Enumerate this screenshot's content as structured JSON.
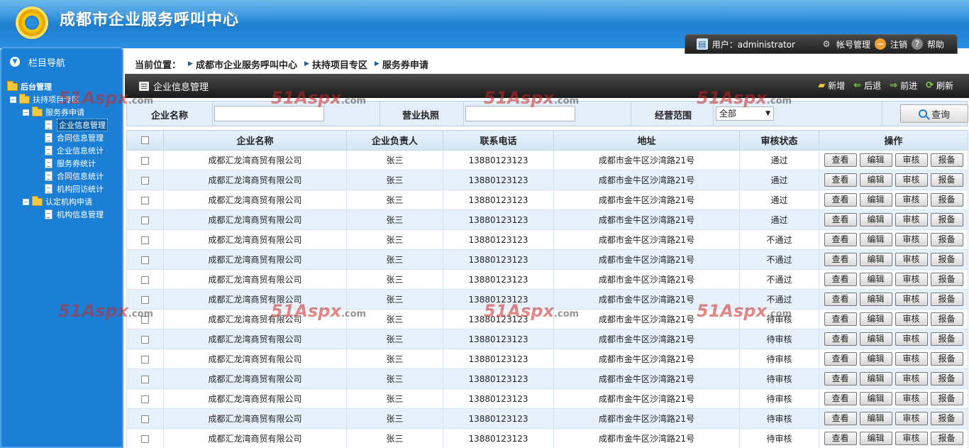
{
  "header": {
    "site_title": "成都市企业服务呼叫中心",
    "user_label": "用户：administrator",
    "account_link": "帐号管理",
    "logout_link": "注销",
    "help_link": "帮助"
  },
  "sidebar": {
    "title": "栏目导航",
    "tree": [
      {
        "label": "后台管理",
        "level": 0,
        "type": "folder",
        "bold": true
      },
      {
        "label": "扶持项目专区",
        "level": 1,
        "type": "folder",
        "toggle": "−"
      },
      {
        "label": "服务券申请",
        "level": 2,
        "type": "folder",
        "toggle": "−"
      },
      {
        "label": "企业信息管理",
        "level": 3,
        "type": "doc",
        "active": true
      },
      {
        "label": "合同信息管理",
        "level": 3,
        "type": "doc"
      },
      {
        "label": "企业信息统计",
        "level": 3,
        "type": "doc"
      },
      {
        "label": "服务券统计",
        "level": 3,
        "type": "doc"
      },
      {
        "label": "合同信息统计",
        "level": 3,
        "type": "doc"
      },
      {
        "label": "机构回访统计",
        "level": 3,
        "type": "doc"
      },
      {
        "label": "认定机构申请",
        "level": 2,
        "type": "folder",
        "toggle": "−"
      },
      {
        "label": "机构信息管理",
        "level": 3,
        "type": "doc"
      }
    ]
  },
  "breadcrumb": {
    "prefix": "当前位置：",
    "items": [
      "成都市企业服务呼叫中心",
      "扶持项目专区",
      "服务券申请"
    ]
  },
  "panel": {
    "title": "企业信息管理",
    "actions": [
      {
        "label": "新增",
        "icon": "folder-add-icon",
        "glyph": "▰",
        "cls": "a-new"
      },
      {
        "label": "后退",
        "icon": "back-arrow-icon",
        "glyph": "⇐",
        "cls": "a-back"
      },
      {
        "label": "前进",
        "icon": "forward-arrow-icon",
        "glyph": "⇒",
        "cls": "a-fwd"
      },
      {
        "label": "刷新",
        "icon": "refresh-icon",
        "glyph": "⟳",
        "cls": "a-refresh"
      }
    ]
  },
  "search": {
    "company_label": "企业名称",
    "company_value": "",
    "license_label": "营业执照",
    "license_value": "",
    "scope_label": "经营范围",
    "scope_selected": "全部",
    "query_button": "查询"
  },
  "table": {
    "headers": [
      "企业名称",
      "企业负责人",
      "联系电话",
      "地址",
      "审核状态",
      "操作"
    ],
    "row_buttons": [
      "查看",
      "编辑",
      "审核",
      "报备"
    ],
    "rows": [
      {
        "name": "成都汇龙湾商贸有限公司",
        "owner": "张三",
        "phone": "13880123123",
        "address": "成都市金牛区沙湾路21号",
        "status": "通过"
      },
      {
        "name": "成都汇龙湾商贸有限公司",
        "owner": "张三",
        "phone": "13880123123",
        "address": "成都市金牛区沙湾路21号",
        "status": "通过"
      },
      {
        "name": "成都汇龙湾商贸有限公司",
        "owner": "张三",
        "phone": "13880123123",
        "address": "成都市金牛区沙湾路21号",
        "status": "通过"
      },
      {
        "name": "成都汇龙湾商贸有限公司",
        "owner": "张三",
        "phone": "13880123123",
        "address": "成都市金牛区沙湾路21号",
        "status": "通过"
      },
      {
        "name": "成都汇龙湾商贸有限公司",
        "owner": "张三",
        "phone": "13880123123",
        "address": "成都市金牛区沙湾路21号",
        "status": "不通过"
      },
      {
        "name": "成都汇龙湾商贸有限公司",
        "owner": "张三",
        "phone": "13880123123",
        "address": "成都市金牛区沙湾路21号",
        "status": "不通过"
      },
      {
        "name": "成都汇龙湾商贸有限公司",
        "owner": "张三",
        "phone": "13880123123",
        "address": "成都市金牛区沙湾路21号",
        "status": "不通过"
      },
      {
        "name": "成都汇龙湾商贸有限公司",
        "owner": "张三",
        "phone": "13880123123",
        "address": "成都市金牛区沙湾路21号",
        "status": "不通过"
      },
      {
        "name": "成都汇龙湾商贸有限公司",
        "owner": "张三",
        "phone": "13880123123",
        "address": "成都市金牛区沙湾路21号",
        "status": "待审核"
      },
      {
        "name": "成都汇龙湾商贸有限公司",
        "owner": "张三",
        "phone": "13880123123",
        "address": "成都市金牛区沙湾路21号",
        "status": "待审核"
      },
      {
        "name": "成都汇龙湾商贸有限公司",
        "owner": "张三",
        "phone": "13880123123",
        "address": "成都市金牛区沙湾路21号",
        "status": "待审核"
      },
      {
        "name": "成都汇龙湾商贸有限公司",
        "owner": "张三",
        "phone": "13880123123",
        "address": "成都市金牛区沙湾路21号",
        "status": "待审核"
      },
      {
        "name": "成都汇龙湾商贸有限公司",
        "owner": "张三",
        "phone": "13880123123",
        "address": "成都市金牛区沙湾路21号",
        "status": "待审核"
      },
      {
        "name": "成都汇龙湾商贸有限公司",
        "owner": "张三",
        "phone": "13880123123",
        "address": "成都市金牛区沙湾路21号",
        "status": "待审核"
      },
      {
        "name": "成都汇龙湾商贸有限公司",
        "owner": "张三",
        "phone": "13880123123",
        "address": "成都市金牛区沙湾路21号",
        "status": "待审核"
      }
    ]
  },
  "watermark": {
    "text": "51Aspx",
    "suffix": ".com"
  }
}
